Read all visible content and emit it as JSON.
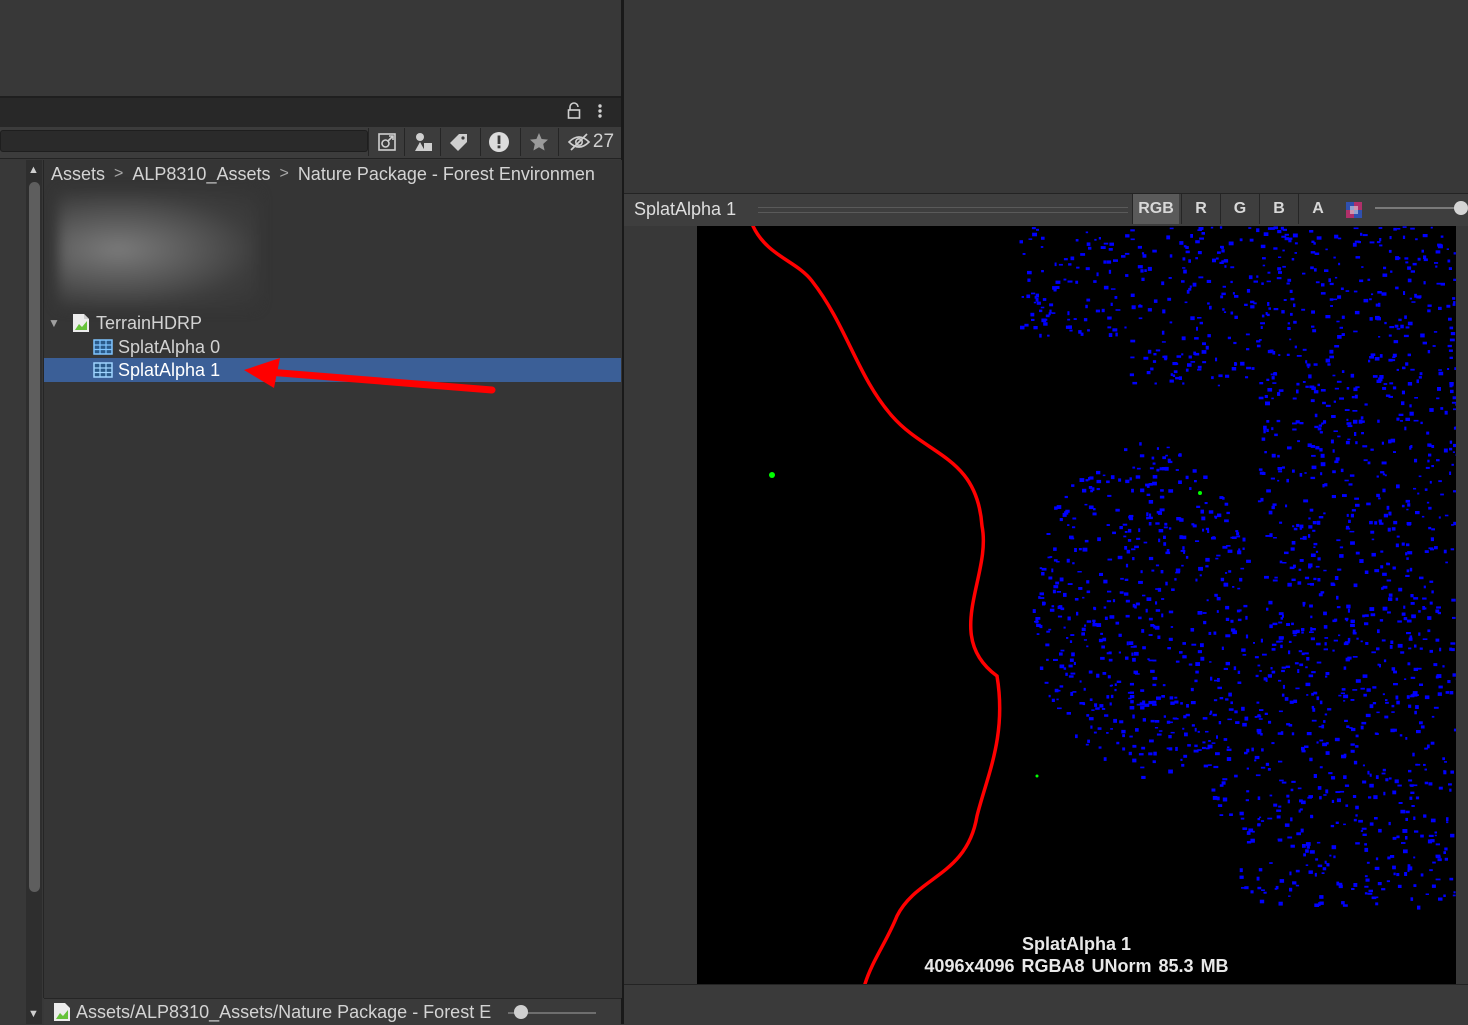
{
  "toolbar": {
    "search_value": "",
    "hidden_count": "27"
  },
  "breadcrumb": [
    "Assets",
    "ALP8310_Assets",
    "Nature Package - Forest Environmen"
  ],
  "tree": {
    "parent_label": "TerrainHDRP",
    "children": [
      {
        "label": "SplatAlpha 0",
        "selected": false
      },
      {
        "label": "SplatAlpha 1",
        "selected": true
      }
    ]
  },
  "footer": {
    "path": "Assets/ALP8310_Assets/Nature Package - Forest E"
  },
  "preview": {
    "title": "SplatAlpha 1",
    "channels": [
      "RGB",
      "R",
      "G",
      "B",
      "A"
    ],
    "texture_name": "SplatAlpha 1",
    "texture_info": "4096x4096  RGBA8 UNorm   85.3 MB"
  },
  "colors": {
    "selection": "#3b5f97",
    "annotation_arrow": "#ff0000",
    "splat_red": "#ff0000",
    "splat_blue": "#0000ff",
    "splat_green": "#00ff00"
  }
}
